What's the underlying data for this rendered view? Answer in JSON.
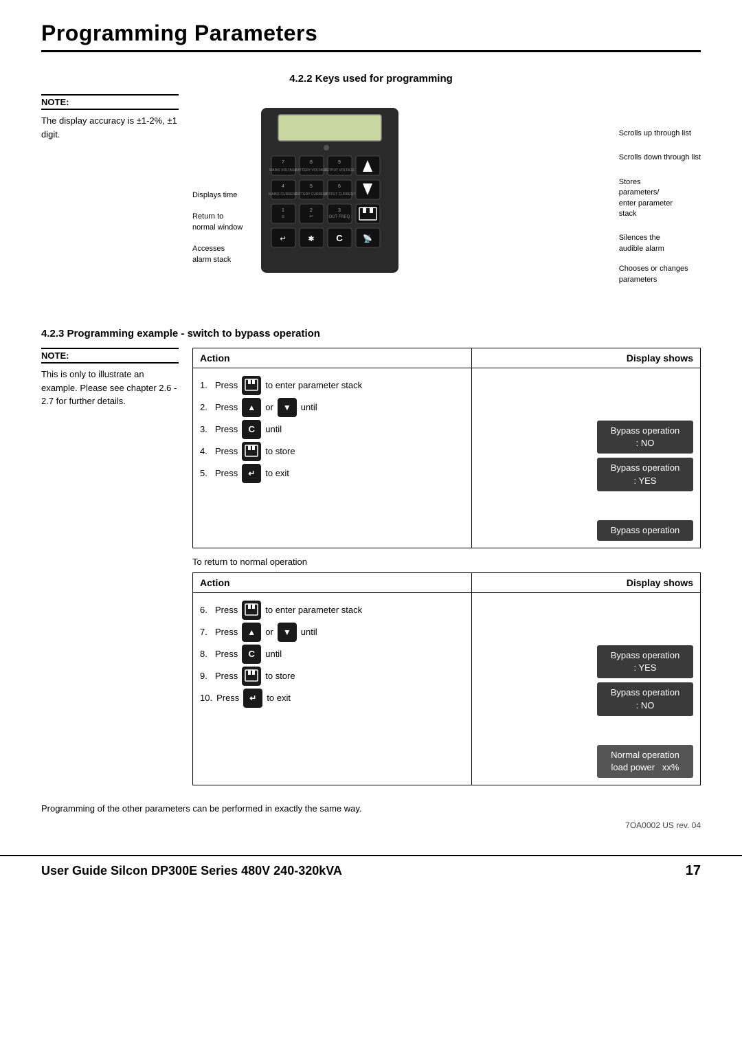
{
  "page": {
    "title": "Programming Parameters",
    "footer_title": "User Guide Silcon DP300E Series 480V 240-320kVA",
    "footer_page": "17",
    "doc_ref": "7OA0002 US rev. 04"
  },
  "section422": {
    "heading": "4.2.2   Keys used for programming"
  },
  "note1": {
    "label": "NOTE:",
    "text": "The display accuracy is ±1-2%, ±1 digit."
  },
  "annotations": {
    "scrolls_up": "Scrolls up\nthrough list",
    "scrolls_down": "Scrolls down\nthrough list",
    "stores": "Stores\nparameters/\nenter parameter\nstack",
    "silences": "Silences the\naudible alarm",
    "chooses": "Chooses or changes\nparameters",
    "displays_time": "Displays time",
    "return_normal": "Return to\nnormal window",
    "accesses": "Accesses\nalarm stack"
  },
  "section423": {
    "heading": "4.2.3   Programming example - switch to bypass operation"
  },
  "note2": {
    "label": "NOTE:",
    "text": "This is only to illustrate an example. Please see chapter 2.6 - 2.7 for further details."
  },
  "table1": {
    "col_action": "Action",
    "col_display": "Display shows",
    "rows": [
      {
        "num": "1.",
        "text": "Press",
        "icon": "store",
        "after": "to enter parameter stack"
      },
      {
        "num": "2.",
        "text": "Press",
        "icon": "up",
        "middle": "or",
        "icon2": "down",
        "after": "until"
      },
      {
        "num": "3.",
        "text": "Press",
        "icon": "c",
        "after": "until"
      },
      {
        "num": "4.",
        "text": "Press",
        "icon": "store",
        "after": "to store"
      },
      {
        "num": "5.",
        "text": "Press",
        "icon": "enter",
        "after": "to exit"
      }
    ],
    "displays": [
      {
        "text": "Bypass operation\n: NO",
        "style": "dark"
      },
      {
        "text": "Bypass operation\n: YES",
        "style": "dark"
      },
      {
        "text": "",
        "style": "none"
      },
      {
        "text": "",
        "style": "none"
      },
      {
        "text": "Bypass operation",
        "style": "dark"
      }
    ]
  },
  "to_return": "To return to normal operation",
  "table2": {
    "col_action": "Action",
    "col_display": "Display shows",
    "rows": [
      {
        "num": "6.",
        "text": "Press",
        "icon": "store",
        "after": "to enter parameter stack"
      },
      {
        "num": "7.",
        "text": "Press",
        "icon": "up",
        "middle": "or",
        "icon2": "down",
        "after": "until"
      },
      {
        "num": "8.",
        "text": "Press",
        "icon": "c",
        "after": "until"
      },
      {
        "num": "9.",
        "text": "Press",
        "icon": "store",
        "after": "to store"
      },
      {
        "num": "10.",
        "text": "Press",
        "icon": "enter",
        "after": "to exit"
      }
    ],
    "displays": [
      {
        "text": "Bypass operation\n: YES",
        "style": "dark"
      },
      {
        "text": "Bypass operation\n: NO",
        "style": "dark"
      },
      {
        "text": "",
        "style": "none"
      },
      {
        "text": "",
        "style": "none"
      },
      {
        "text": "Normal operation\nload power   xx%",
        "style": "normal"
      }
    ]
  },
  "bottom_text": "Programming of the other parameters can be performed in exactly the same way."
}
